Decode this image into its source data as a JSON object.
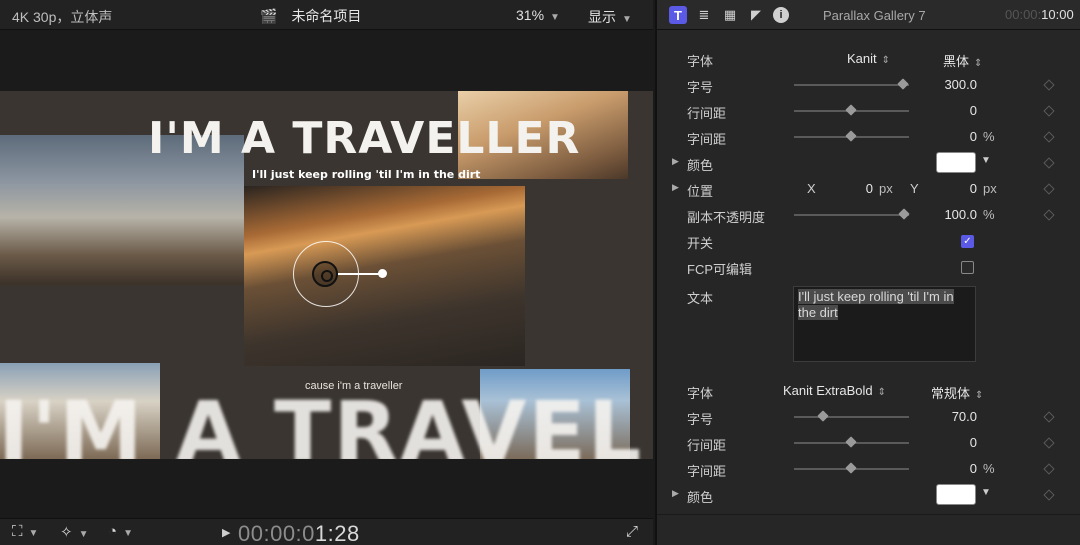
{
  "viewer": {
    "format": "4K 30p，立体声",
    "project_name": "未命名项目",
    "zoom": "31%",
    "display_menu": "显示",
    "canvas": {
      "title_top": "I'M A TRAVELLER",
      "subtitle_top": "I'll just keep rolling 'til I'm in the dirt",
      "subtitle_bottom": "cause i'm a traveller",
      "title_bottom": "I'M A TRAVEL"
    },
    "timecode_dim": "00:00:0",
    "timecode_bright": "1:28"
  },
  "inspector": {
    "title": "Parallax Gallery 7",
    "time_dim": "00:00:",
    "time_bright": "10:00",
    "section1": {
      "font_label": "字体",
      "font_value": "Kanit",
      "weight_value": "黑体",
      "size_label": "字号",
      "size_value": "300.0",
      "size_fraction": 0.95,
      "line_spacing_label": "行间距",
      "line_spacing_value": "0",
      "tracking_label": "字间距",
      "tracking_value": "0",
      "tracking_unit": "%",
      "color_label": "颜色",
      "color_value": "#ffffff",
      "position_label": "位置",
      "x_label": "X",
      "x_value": "0",
      "x_unit": "px",
      "y_label": "Y",
      "y_value": "0",
      "y_unit": "px",
      "copy_opacity_label": "副本不透明度",
      "copy_opacity_value": "100.0",
      "copy_opacity_unit": "%",
      "switch_label": "开关",
      "switch_checked": true,
      "fcp_editable_label": "FCP可编辑",
      "fcp_editable_checked": false,
      "text_label": "文本",
      "text_value": "I'll just keep rolling 'til I'm in the dirt"
    },
    "section2": {
      "font_label": "字体",
      "font_value": "Kanit ExtraBold",
      "weight_value": "常规体",
      "size_label": "字号",
      "size_value": "70.0",
      "size_fraction": 0.25,
      "line_spacing_label": "行间距",
      "line_spacing_value": "0",
      "tracking_label": "字间距",
      "tracking_value": "0",
      "tracking_unit": "%",
      "color_label": "颜色",
      "color_value": "#ffffff"
    }
  }
}
